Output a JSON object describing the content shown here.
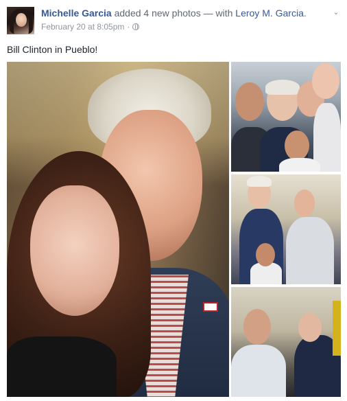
{
  "post": {
    "author": "Michelle Garcia",
    "action": " added 4 new photos — with ",
    "tagged": "Leroy M. Garcia",
    "tagged_suffix": ".",
    "timestamp": "February 20 at 8:05pm",
    "separator": "·",
    "privacy_icon": "globe-icon",
    "menu_icon": "chevron-down-icon",
    "text": "Bill Clinton in Pueblo!"
  },
  "photos": [
    {
      "name": "main-photo"
    },
    {
      "name": "photo-2"
    },
    {
      "name": "photo-3"
    },
    {
      "name": "photo-4"
    }
  ],
  "colors": {
    "link": "#365899",
    "meta": "#90949c",
    "text": "#1d2129"
  }
}
